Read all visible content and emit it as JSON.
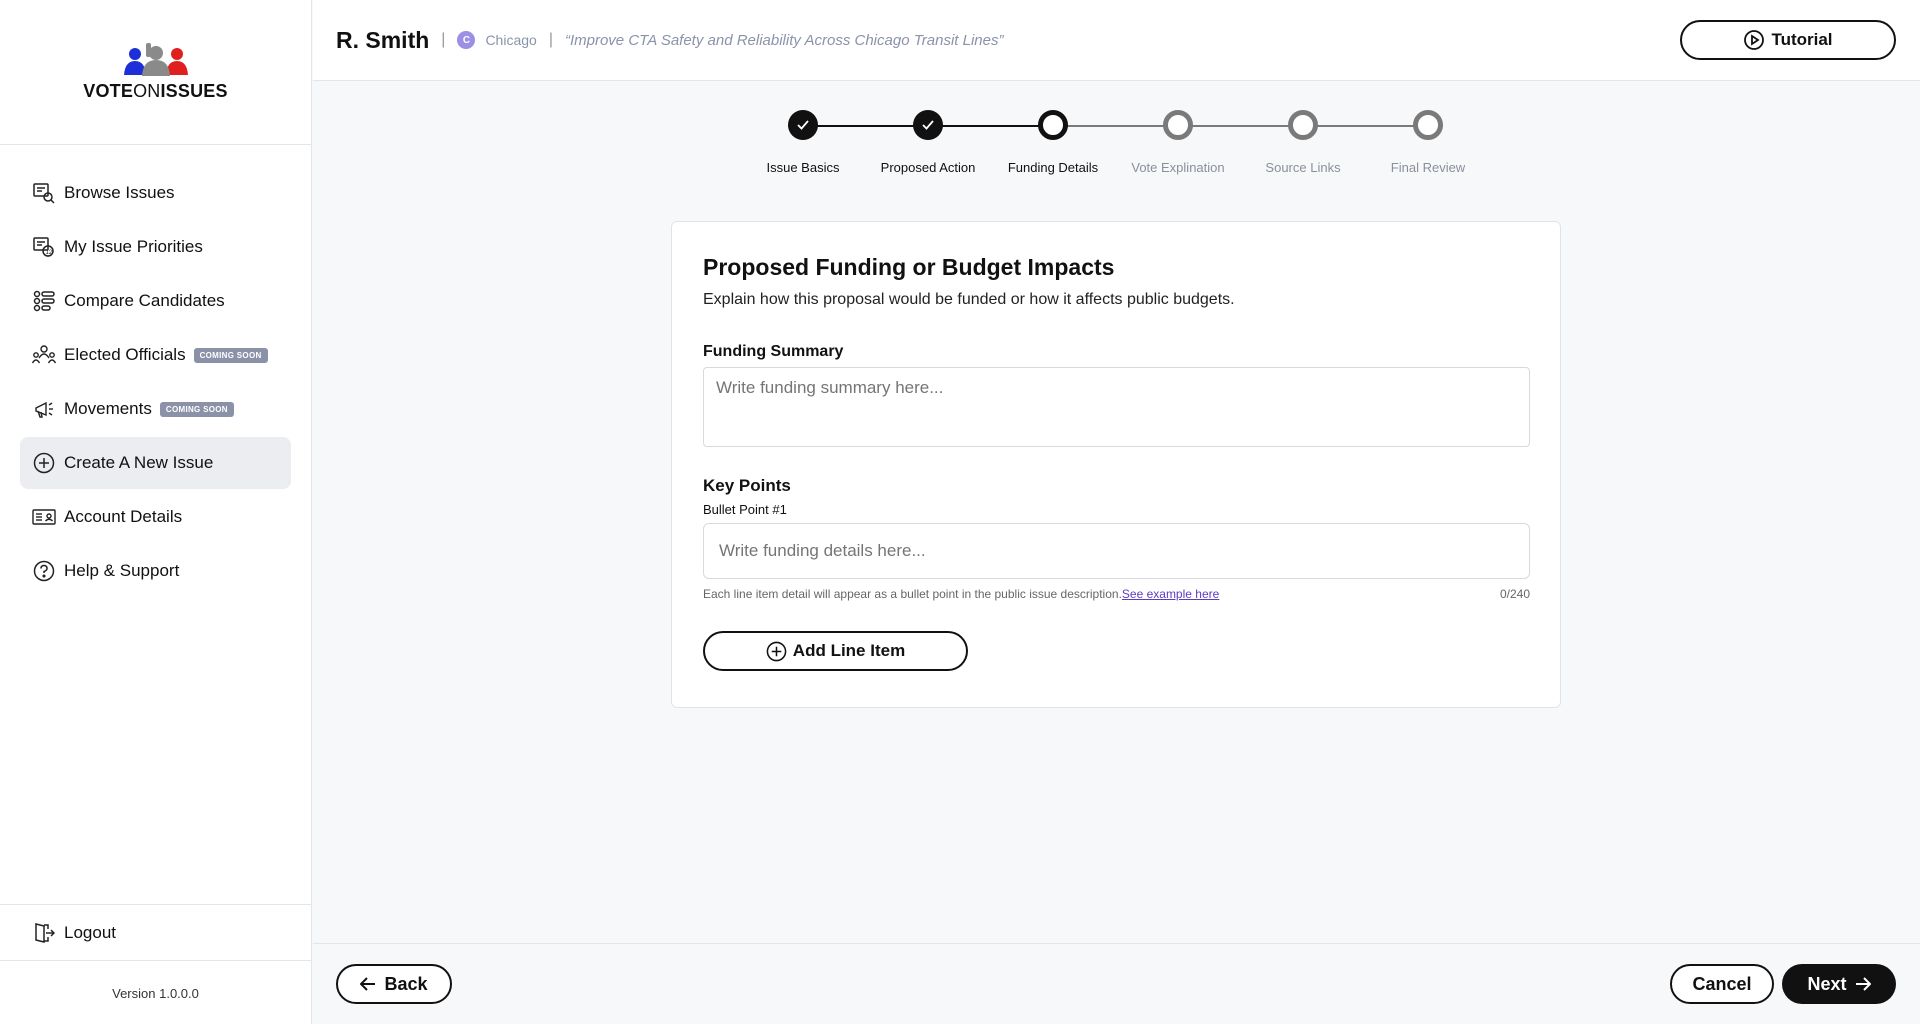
{
  "app": {
    "logo_text_vote": "VOTE",
    "logo_text_on": "ON",
    "logo_text_issues": "ISSUES",
    "version": "Version 1.0.0.0"
  },
  "sidebar": {
    "items": [
      {
        "label": "Browse Issues",
        "icon": "browse-issues-icon"
      },
      {
        "label": "My Issue Priorities",
        "icon": "issue-priorities-icon"
      },
      {
        "label": "Compare Candidates",
        "icon": "compare-candidates-icon"
      },
      {
        "label": "Elected Officials",
        "icon": "elected-officials-icon",
        "badge": "COMING SOON"
      },
      {
        "label": "Movements",
        "icon": "megaphone-icon",
        "badge": "COMING SOON"
      },
      {
        "label": "Create A New Issue",
        "icon": "plus-circle-icon",
        "active": true
      },
      {
        "label": "Account Details",
        "icon": "id-card-icon"
      },
      {
        "label": "Help & Support",
        "icon": "help-circle-icon"
      }
    ],
    "logout_label": "Logout"
  },
  "header": {
    "user_name": "R. Smith",
    "separator": "|",
    "city_initial": "C",
    "city": "Chicago",
    "issue_title": "“Improve CTA Safety and Reliability Across Chicago Transit Lines”",
    "tutorial_label": "Tutorial"
  },
  "stepper": {
    "steps": [
      {
        "label": "Issue Basics",
        "state": "done"
      },
      {
        "label": "Proposed Action",
        "state": "done"
      },
      {
        "label": "Funding Details",
        "state": "current"
      },
      {
        "label": "Vote Explination",
        "state": "pending"
      },
      {
        "label": "Source Links",
        "state": "pending"
      },
      {
        "label": "Final Review",
        "state": "pending"
      }
    ]
  },
  "form": {
    "title": "Proposed Funding or Budget Impacts",
    "subtitle": "Explain how this proposal would be funded or how it affects public budgets.",
    "funding_summary_label": "Funding Summary",
    "funding_summary_placeholder": "Write funding summary here...",
    "funding_summary_value": "",
    "key_points_label": "Key Points",
    "bullet_label": "Bullet Point #1",
    "bullet_placeholder": "Write funding details here...",
    "bullet_value": "",
    "helper_text": "Each line item detail will appear as a bullet point in the public issue description.",
    "helper_link": "See example here",
    "char_count": "0/240",
    "add_line_item_label": "Add Line Item"
  },
  "footer": {
    "back_label": "Back",
    "cancel_label": "Cancel",
    "next_label": "Next"
  },
  "colors": {
    "accent": "#111111",
    "badge": "#8b92a8",
    "link": "#5b3cc4",
    "active_nav_bg": "#ebedf1"
  }
}
